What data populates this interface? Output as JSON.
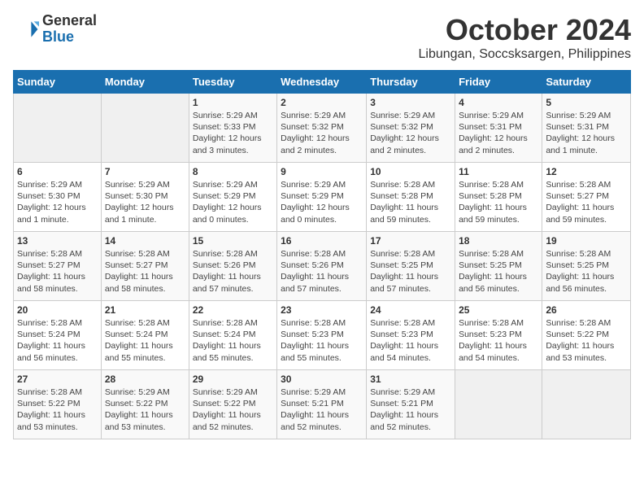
{
  "header": {
    "logo_line1": "General",
    "logo_line2": "Blue",
    "month": "October 2024",
    "location": "Libungan, Soccsksargen, Philippines"
  },
  "weekdays": [
    "Sunday",
    "Monday",
    "Tuesday",
    "Wednesday",
    "Thursday",
    "Friday",
    "Saturday"
  ],
  "weeks": [
    [
      {
        "day": "",
        "info": ""
      },
      {
        "day": "",
        "info": ""
      },
      {
        "day": "1",
        "info": "Sunrise: 5:29 AM\nSunset: 5:33 PM\nDaylight: 12 hours and 3 minutes."
      },
      {
        "day": "2",
        "info": "Sunrise: 5:29 AM\nSunset: 5:32 PM\nDaylight: 12 hours and 2 minutes."
      },
      {
        "day": "3",
        "info": "Sunrise: 5:29 AM\nSunset: 5:32 PM\nDaylight: 12 hours and 2 minutes."
      },
      {
        "day": "4",
        "info": "Sunrise: 5:29 AM\nSunset: 5:31 PM\nDaylight: 12 hours and 2 minutes."
      },
      {
        "day": "5",
        "info": "Sunrise: 5:29 AM\nSunset: 5:31 PM\nDaylight: 12 hours and 1 minute."
      }
    ],
    [
      {
        "day": "6",
        "info": "Sunrise: 5:29 AM\nSunset: 5:30 PM\nDaylight: 12 hours and 1 minute."
      },
      {
        "day": "7",
        "info": "Sunrise: 5:29 AM\nSunset: 5:30 PM\nDaylight: 12 hours and 1 minute."
      },
      {
        "day": "8",
        "info": "Sunrise: 5:29 AM\nSunset: 5:29 PM\nDaylight: 12 hours and 0 minutes."
      },
      {
        "day": "9",
        "info": "Sunrise: 5:29 AM\nSunset: 5:29 PM\nDaylight: 12 hours and 0 minutes."
      },
      {
        "day": "10",
        "info": "Sunrise: 5:28 AM\nSunset: 5:28 PM\nDaylight: 11 hours and 59 minutes."
      },
      {
        "day": "11",
        "info": "Sunrise: 5:28 AM\nSunset: 5:28 PM\nDaylight: 11 hours and 59 minutes."
      },
      {
        "day": "12",
        "info": "Sunrise: 5:28 AM\nSunset: 5:27 PM\nDaylight: 11 hours and 59 minutes."
      }
    ],
    [
      {
        "day": "13",
        "info": "Sunrise: 5:28 AM\nSunset: 5:27 PM\nDaylight: 11 hours and 58 minutes."
      },
      {
        "day": "14",
        "info": "Sunrise: 5:28 AM\nSunset: 5:27 PM\nDaylight: 11 hours and 58 minutes."
      },
      {
        "day": "15",
        "info": "Sunrise: 5:28 AM\nSunset: 5:26 PM\nDaylight: 11 hours and 57 minutes."
      },
      {
        "day": "16",
        "info": "Sunrise: 5:28 AM\nSunset: 5:26 PM\nDaylight: 11 hours and 57 minutes."
      },
      {
        "day": "17",
        "info": "Sunrise: 5:28 AM\nSunset: 5:25 PM\nDaylight: 11 hours and 57 minutes."
      },
      {
        "day": "18",
        "info": "Sunrise: 5:28 AM\nSunset: 5:25 PM\nDaylight: 11 hours and 56 minutes."
      },
      {
        "day": "19",
        "info": "Sunrise: 5:28 AM\nSunset: 5:25 PM\nDaylight: 11 hours and 56 minutes."
      }
    ],
    [
      {
        "day": "20",
        "info": "Sunrise: 5:28 AM\nSunset: 5:24 PM\nDaylight: 11 hours and 56 minutes."
      },
      {
        "day": "21",
        "info": "Sunrise: 5:28 AM\nSunset: 5:24 PM\nDaylight: 11 hours and 55 minutes."
      },
      {
        "day": "22",
        "info": "Sunrise: 5:28 AM\nSunset: 5:24 PM\nDaylight: 11 hours and 55 minutes."
      },
      {
        "day": "23",
        "info": "Sunrise: 5:28 AM\nSunset: 5:23 PM\nDaylight: 11 hours and 55 minutes."
      },
      {
        "day": "24",
        "info": "Sunrise: 5:28 AM\nSunset: 5:23 PM\nDaylight: 11 hours and 54 minutes."
      },
      {
        "day": "25",
        "info": "Sunrise: 5:28 AM\nSunset: 5:23 PM\nDaylight: 11 hours and 54 minutes."
      },
      {
        "day": "26",
        "info": "Sunrise: 5:28 AM\nSunset: 5:22 PM\nDaylight: 11 hours and 53 minutes."
      }
    ],
    [
      {
        "day": "27",
        "info": "Sunrise: 5:28 AM\nSunset: 5:22 PM\nDaylight: 11 hours and 53 minutes."
      },
      {
        "day": "28",
        "info": "Sunrise: 5:29 AM\nSunset: 5:22 PM\nDaylight: 11 hours and 53 minutes."
      },
      {
        "day": "29",
        "info": "Sunrise: 5:29 AM\nSunset: 5:22 PM\nDaylight: 11 hours and 52 minutes."
      },
      {
        "day": "30",
        "info": "Sunrise: 5:29 AM\nSunset: 5:21 PM\nDaylight: 11 hours and 52 minutes."
      },
      {
        "day": "31",
        "info": "Sunrise: 5:29 AM\nSunset: 5:21 PM\nDaylight: 11 hours and 52 minutes."
      },
      {
        "day": "",
        "info": ""
      },
      {
        "day": "",
        "info": ""
      }
    ]
  ]
}
